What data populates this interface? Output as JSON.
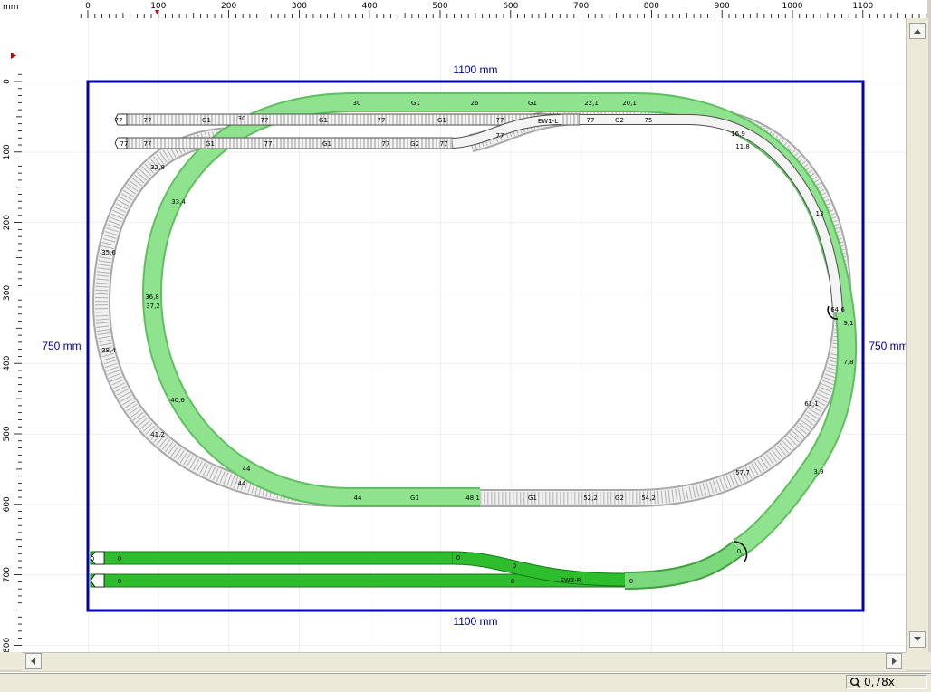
{
  "ruler": {
    "unit": "mm",
    "top_ticks": [
      "0",
      "100",
      "200",
      "300",
      "400",
      "500",
      "600",
      "700",
      "800",
      "900",
      "1000",
      "1100"
    ],
    "left_ticks": [
      "0",
      "100",
      "200",
      "300",
      "400",
      "500",
      "600",
      "700",
      "800"
    ]
  },
  "board": {
    "width_label": "1100 mm",
    "height_label": "750 mm",
    "border_color": "#0000b0"
  },
  "track_labels": {
    "upper_gray": [
      "30",
      "G1",
      "26",
      "G1",
      "22,1",
      "20,1",
      "30",
      "77",
      "G1",
      "77",
      "G1",
      "77",
      "77",
      "EW1-L",
      "77",
      "G2",
      "75",
      "77",
      "77",
      "77",
      "G1",
      "77",
      "G1",
      "77",
      "G2",
      "77",
      "16,9",
      "11,8",
      "13",
      "64,6",
      "9,1",
      "32,8",
      "33,4",
      "35,6",
      "36,8",
      "37,2",
      "38,4",
      "40,6",
      "41,2",
      "44",
      "44",
      "44",
      "G1",
      "48,1",
      "G1",
      "52,2",
      "G2",
      "54,2",
      "57,7",
      "61,1",
      "3,9",
      "7,8",
      "G1",
      "77"
    ],
    "lower_green": [
      "0",
      "0",
      "0",
      "0",
      "0",
      "0",
      "EW2-R",
      "0",
      "0"
    ]
  },
  "zoom": {
    "icon": "magnifier-icon",
    "value": "0,78x"
  },
  "colors": {
    "green_track": "#7cd87c",
    "green_dark": "#22b822",
    "gray_track": "#e8e8e8",
    "grid": "#e0e0e0"
  }
}
